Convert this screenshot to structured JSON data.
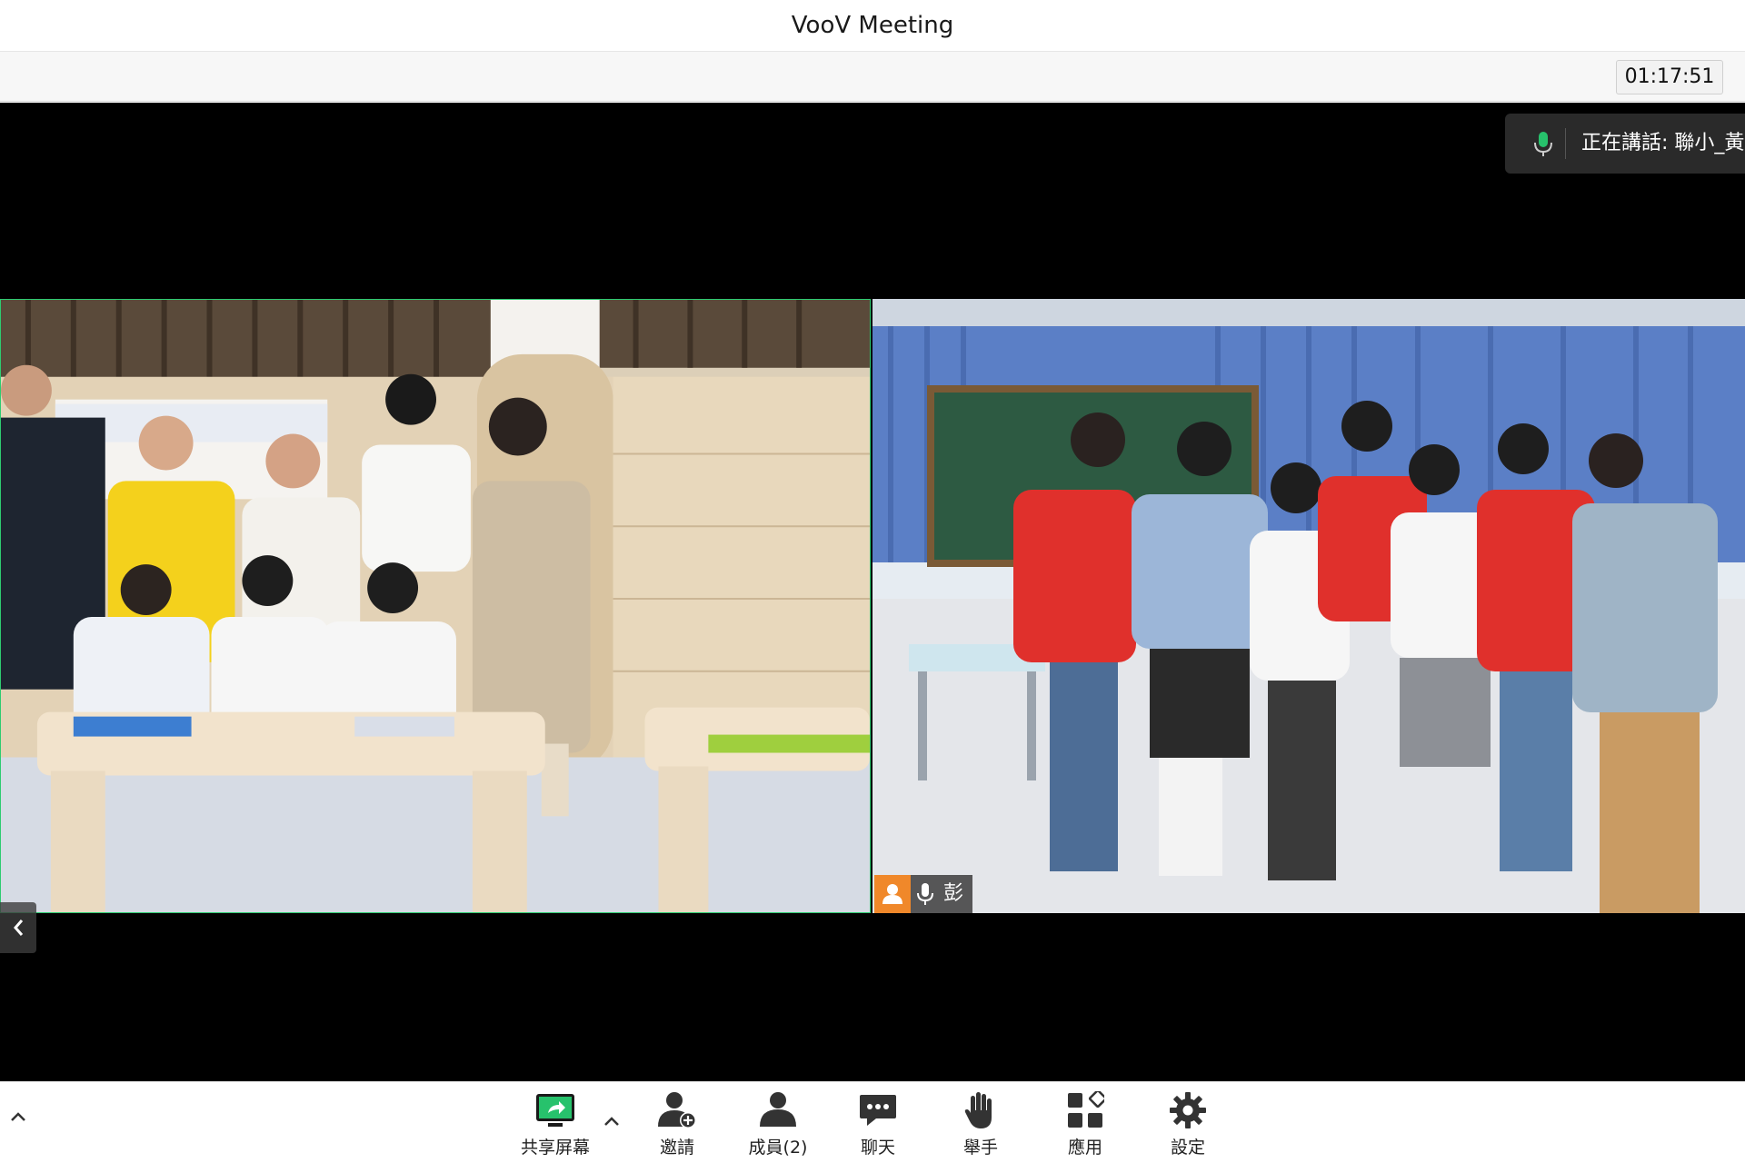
{
  "app": {
    "title": "VooV Meeting"
  },
  "infobar": {
    "timer": "01:17:51"
  },
  "speaker": {
    "label": "正在講話: 聯小_黃"
  },
  "tiles": {
    "right": {
      "participant_name": "彭"
    }
  },
  "toolbar": {
    "share_label": "共享屏幕",
    "invite_label": "邀請",
    "members_label": "成員(2)",
    "chat_label": "聊天",
    "raise_hand_label": "舉手",
    "apps_label": "應用",
    "settings_label": "設定"
  },
  "colors": {
    "accent_green": "#2ecc71",
    "avatar_orange": "#f0882a",
    "mic_active": "#27c26c"
  }
}
